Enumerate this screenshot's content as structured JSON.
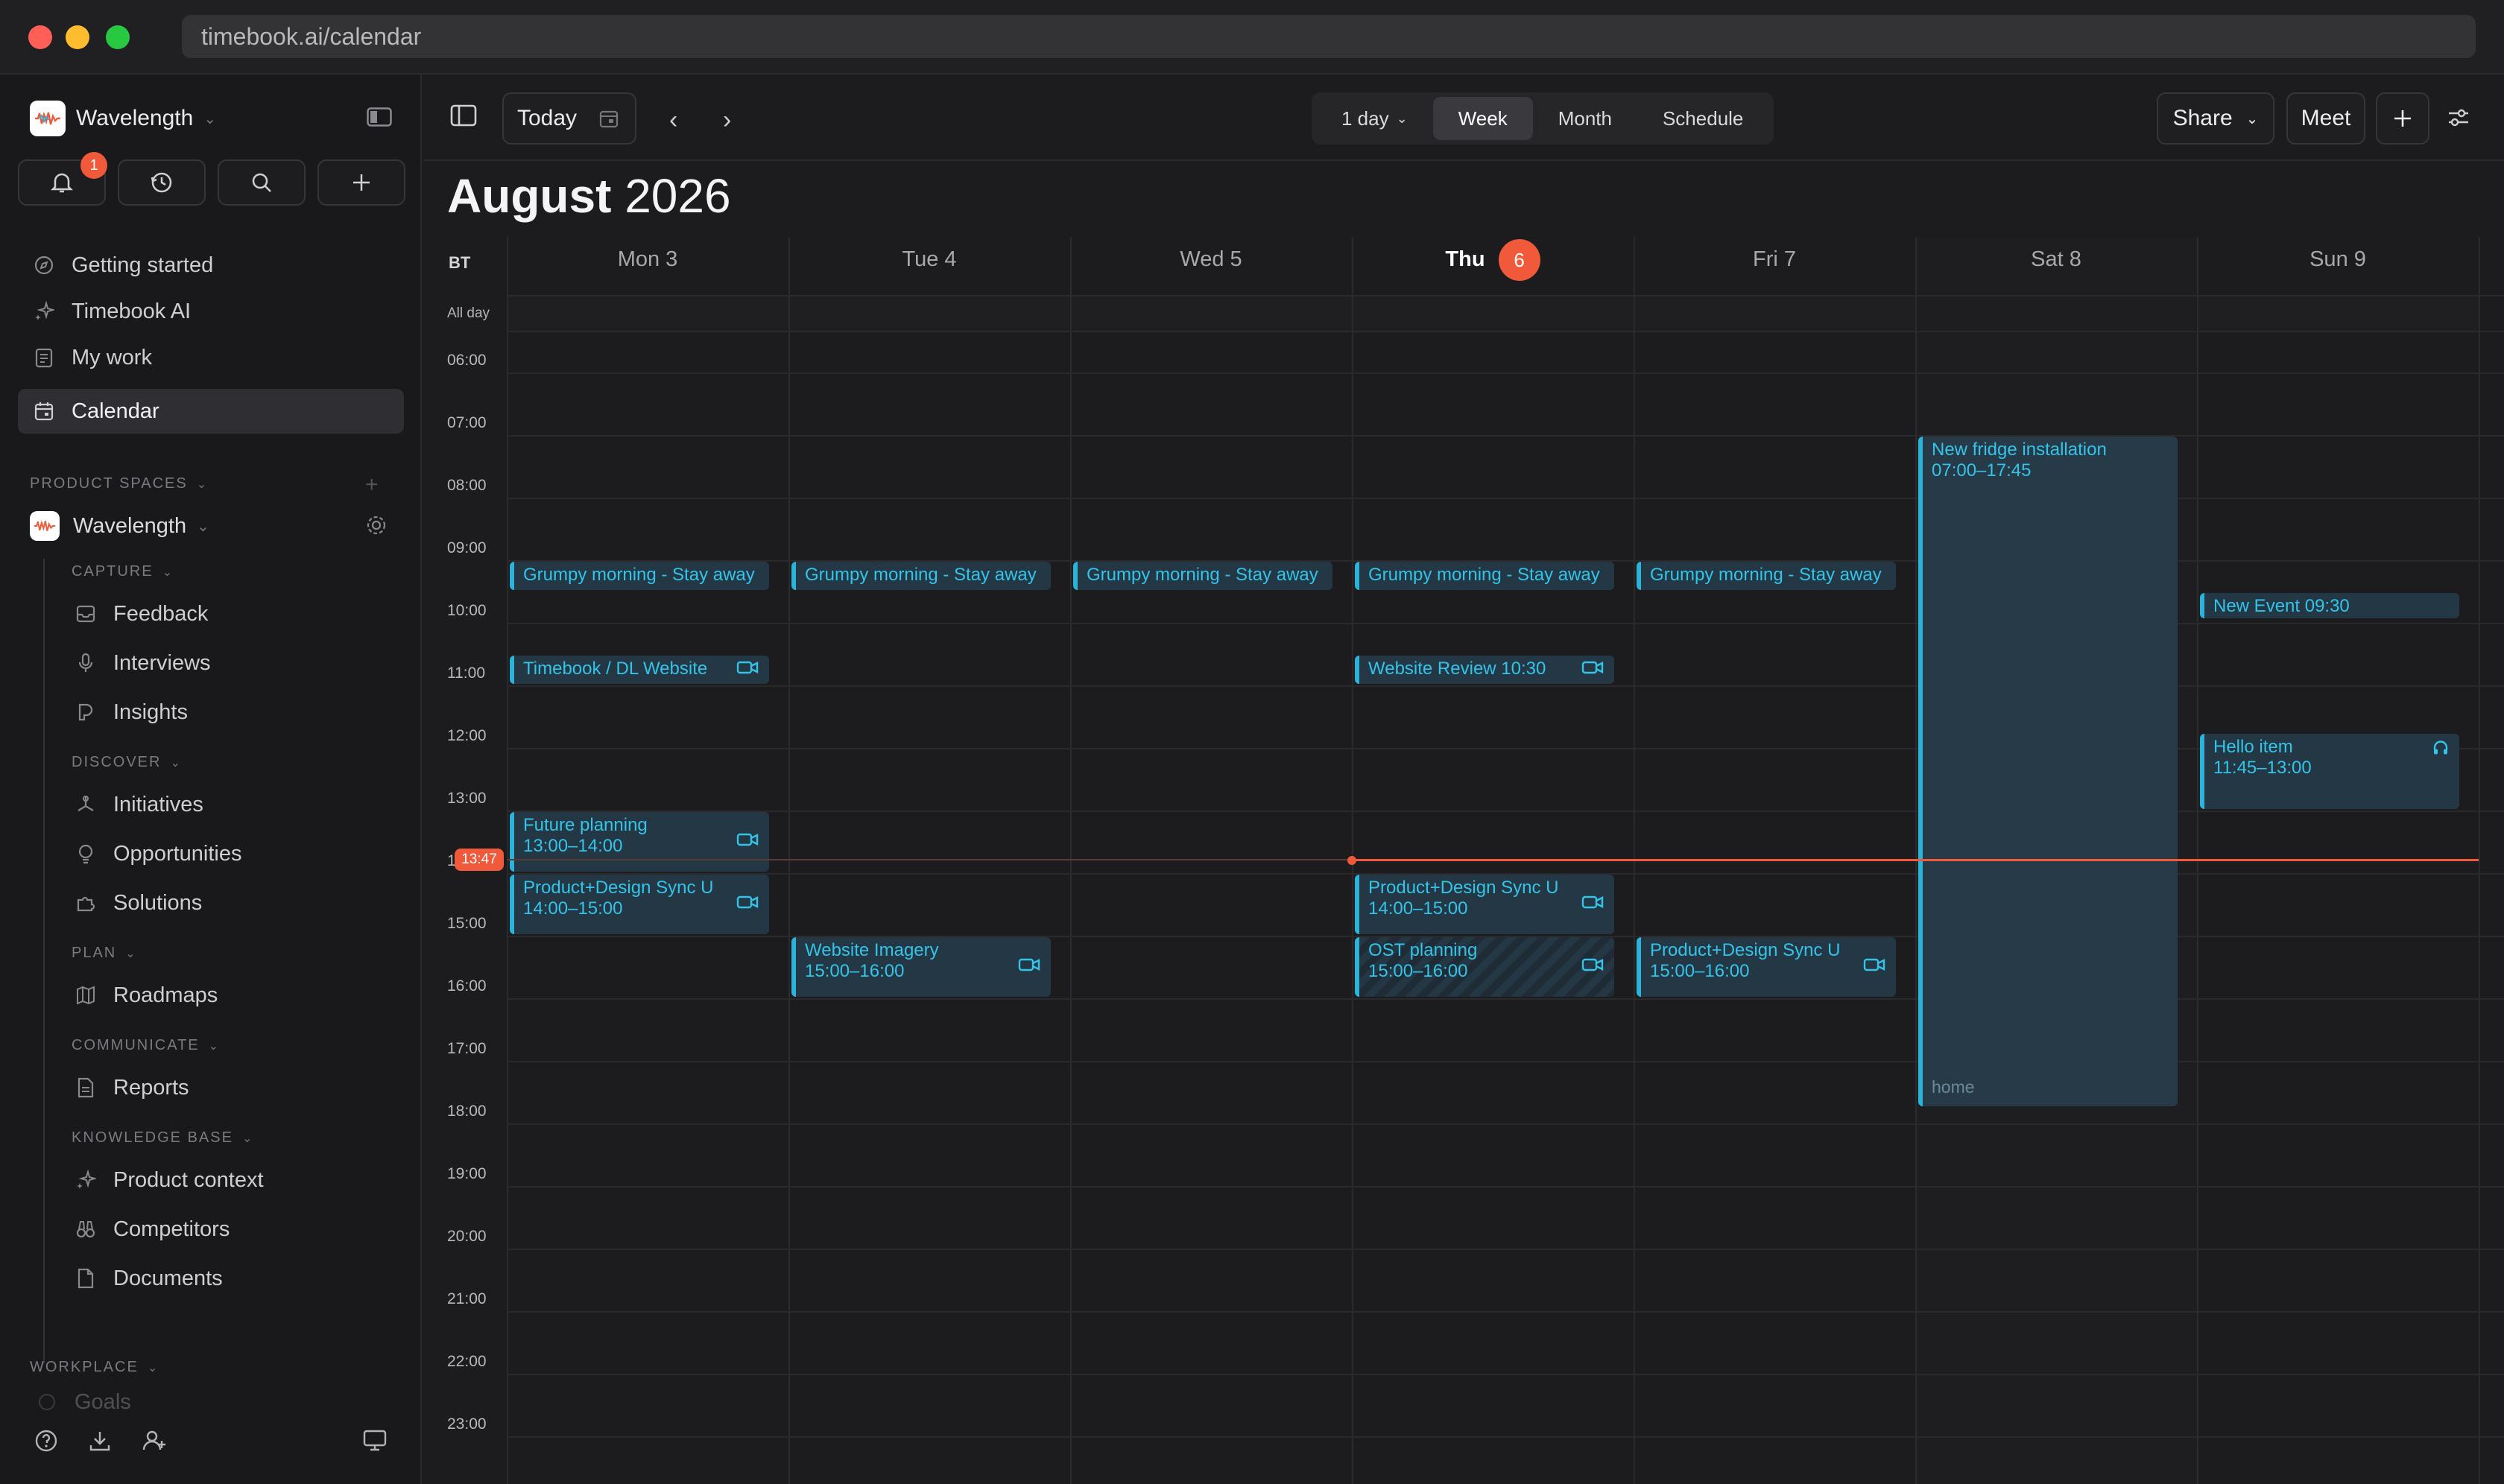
{
  "browser": {
    "url": "timebook.ai/calendar"
  },
  "sidebar": {
    "workspace": "Wavelength",
    "notification_count": "1",
    "nav": [
      {
        "label": "Getting started",
        "icon": "compass-icon"
      },
      {
        "label": "Timebook AI",
        "icon": "sparkles-icon"
      },
      {
        "label": "My work",
        "icon": "clipboard-icon"
      },
      {
        "label": "Calendar",
        "icon": "calendar-icon"
      }
    ],
    "product_spaces_label": "PRODUCT SPACES",
    "space_name": "Wavelength",
    "sections": {
      "capture": "CAPTURE",
      "discover": "DISCOVER",
      "plan": "PLAN",
      "communicate": "COMMUNICATE",
      "knowledge_base": "KNOWLEDGE BASE",
      "workplace": "WORKPLACE"
    },
    "items": {
      "feedback": "Feedback",
      "interviews": "Interviews",
      "insights": "Insights",
      "initiatives": "Initiatives",
      "opportunities": "Opportunities",
      "solutions": "Solutions",
      "roadmaps": "Roadmaps",
      "reports": "Reports",
      "product_context": "Product context",
      "competitors": "Competitors",
      "documents": "Documents",
      "goals": "Goals"
    }
  },
  "toolbar": {
    "today": "Today",
    "range_select": "1 day",
    "views": [
      "Week",
      "Month",
      "Schedule"
    ],
    "active_view": "Week",
    "share": "Share",
    "meet": "Meet"
  },
  "calendar": {
    "month": "August",
    "year": "2026",
    "timezone": "BT",
    "all_day": "All day",
    "days": [
      {
        "name": "Mon 3"
      },
      {
        "name": "Tue 4"
      },
      {
        "name": "Wed 5"
      },
      {
        "name": "Thu",
        "today_number": "6"
      },
      {
        "name": "Fri 7"
      },
      {
        "name": "Sat 8"
      },
      {
        "name": "Sun 9"
      }
    ],
    "hours": [
      "06:00",
      "07:00",
      "08:00",
      "09:00",
      "10:00",
      "11:00",
      "12:00",
      "13:00",
      "14:00",
      "15:00",
      "16:00",
      "17:00",
      "18:00",
      "19:00",
      "20:00",
      "21:00",
      "22:00",
      "23:00"
    ],
    "now_time": "13:47",
    "events": [
      {
        "day": 0,
        "title": "Grumpy morning - Stay away",
        "start": "09:00",
        "end": "09:30",
        "video": false
      },
      {
        "day": 1,
        "title": "Grumpy morning - Stay away",
        "start": "09:00",
        "end": "09:30",
        "video": false
      },
      {
        "day": 2,
        "title": "Grumpy morning - Stay away",
        "start": "09:00",
        "end": "09:30",
        "video": false
      },
      {
        "day": 3,
        "title": "Grumpy morning - Stay away",
        "start": "09:00",
        "end": "09:30",
        "video": false
      },
      {
        "day": 4,
        "title": "Grumpy morning - Stay away",
        "start": "09:00",
        "end": "09:30",
        "video": false
      },
      {
        "day": 0,
        "title": "Timebook / DL Website",
        "start": "10:30",
        "end": "11:00",
        "video": true
      },
      {
        "day": 3,
        "title": "Website Review",
        "time_text": "10:30",
        "start": "10:30",
        "end": "11:00",
        "video": true
      },
      {
        "day": 0,
        "title": "Future planning",
        "time_text": "13:00–14:00",
        "start": "13:00",
        "end": "14:00",
        "video": true
      },
      {
        "day": 0,
        "title": "Product+Design Sync U",
        "time_text": "14:00–15:00",
        "start": "14:00",
        "end": "15:00",
        "video": true
      },
      {
        "day": 3,
        "title": "Product+Design Sync U",
        "time_text": "14:00–15:00",
        "start": "14:00",
        "end": "15:00",
        "video": true
      },
      {
        "day": 1,
        "title": "Website Imagery",
        "time_text": "15:00–16:00",
        "start": "15:00",
        "end": "16:00",
        "video": true
      },
      {
        "day": 3,
        "title": "OST planning",
        "time_text": "15:00–16:00",
        "start": "15:00",
        "end": "16:00",
        "video": true,
        "hatched": true
      },
      {
        "day": 4,
        "title": "Product+Design Sync U",
        "time_text": "15:00–16:00",
        "start": "15:00",
        "end": "16:00",
        "video": true
      },
      {
        "day": 5,
        "title": "New fridge installation",
        "time_text": "07:00–17:45",
        "start": "07:00",
        "end": "17:45",
        "video": false,
        "location": "home"
      },
      {
        "day": 6,
        "title": "New Event",
        "time_text": "09:30",
        "start": "09:30",
        "end": "09:45",
        "video": false
      },
      {
        "day": 6,
        "title": "Hello item",
        "time_text": "11:45–13:00",
        "start": "11:45",
        "end": "13:00",
        "video": false,
        "headphones": true
      }
    ]
  },
  "colors": {
    "accent": "#f0593a",
    "event_text": "#33c4ea",
    "event_bg": "#243744"
  }
}
